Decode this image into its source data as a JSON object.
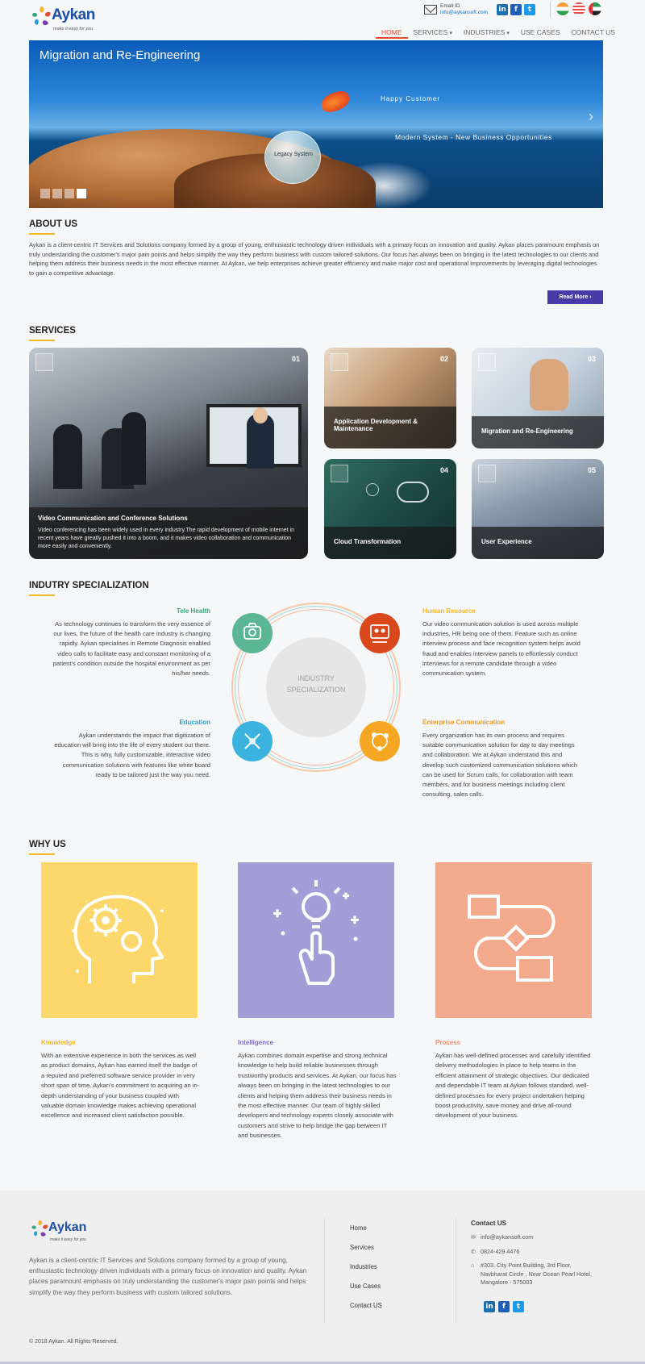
{
  "brand": {
    "name": "Aykan",
    "tagline": "make it easy for you"
  },
  "contact_top": {
    "label": "Email ID",
    "email": "info@aykansoft.com"
  },
  "social": [
    "linkedin-icon",
    "facebook-icon",
    "twitter-icon"
  ],
  "nav": [
    {
      "label": "HOME",
      "active": true,
      "dropdown": false
    },
    {
      "label": "SERVICES",
      "active": false,
      "dropdown": true
    },
    {
      "label": "INDUSTRIES",
      "active": false,
      "dropdown": true
    },
    {
      "label": "USE CASES",
      "active": false,
      "dropdown": false
    },
    {
      "label": "CONTACT US",
      "active": false,
      "dropdown": false
    }
  ],
  "hero": {
    "title": "Migration and Re-Engineering",
    "caption_top": "Happy Customer",
    "caption_bottom": "Modern System - New Business Opportunities",
    "bowl_label": "Legacy System"
  },
  "about": {
    "title": "ABOUT US",
    "text": "Aykan is a client-centric IT Services and Solutions company formed by a group of young, enthusiastic technology driven individuals with a primary focus on innovation and quality. Aykan places paramount emphasis on truly understanding the customer's major pain points and helps simplify the way they perform business with custom tailored solutions. Our focus has always been on bringing in the latest technologies to our clients and helping them address their business needs in the most effective manner. At Aykan, we help enterprises achieve greater efficiency and make major cost and operational improvements by leveraging digital technologies to gain a competitive advantage.",
    "button": "Read More ›"
  },
  "services": {
    "title": "SERVICES",
    "items": [
      {
        "num": "01",
        "title": "Video Communication and Conference Solutions",
        "desc": "Video conferencing has been widely used in every industry.The rapid development of mobile internet in recent years have greatly pushed it into a boom, and it makes video collaboration and communication more easily and conveniently."
      },
      {
        "num": "02",
        "title": "Application Development & Maintenance",
        "desc": ""
      },
      {
        "num": "03",
        "title": "Migration and Re-Engineering",
        "desc": ""
      },
      {
        "num": "04",
        "title": "Cloud Transformation",
        "desc": ""
      },
      {
        "num": "05",
        "title": "User Experience",
        "desc": ""
      }
    ]
  },
  "industry": {
    "title": "INDUTRY SPECIALIZATION",
    "center_label": "INDUSTRY SPECIALIZATION",
    "items": [
      {
        "title": "Tele Health",
        "color": "#3aa57a",
        "text": "As technology continues to transform the very essence of our lives, the future of the health care industry is changing rapidly. Aykan specialises in Remote Diagnosis enabled video calls to facilitate easy and constant monitoring of a patient's condition outside the hospital environment as per his/her needs."
      },
      {
        "title": "Human Resource",
        "color": "#f2b62c",
        "text": "Our video communication solution is used across multiple industries, HR being one of them. Feature such as online interview process and face recognition system helps avoid fraud and enables interview panels to effortlessly conduct interviews for a remote candidate through a video communication system."
      },
      {
        "title": "Education",
        "color": "#2b9fd6",
        "text": "Aykan understands the impact that digitization of education will bring into the life of every student out there. This is why, fully customizable, interactive video communication solutions with features like white board ready to be tailored just the way you need."
      },
      {
        "title": "Enterprise Communication",
        "color": "#f39a2c",
        "text": "Every organization has its own process and requires suitable communication solution for day to day meetings and collaboration. We at Aykan understand this and develop such customized communication solutions which can be used for Scrum calls, for collaboration with team members, and for business meetings including client consulting, sales calls."
      }
    ]
  },
  "why": {
    "title": "WHY US",
    "items": [
      {
        "title": "Knowledge",
        "color": "#f2b62c",
        "bg": "#fbd76c",
        "text": "With an extensive experience in both the services as well as product domains, Aykan has earned itself the badge of a reputed and preferred software service provider in very short span of time. Aykan's commitment to acquiring an in-depth understanding of your business coupled with valuable domain knowledge makes achieving operational excellence and increased client satisfaction possible."
      },
      {
        "title": "Intelligence",
        "color": "#7a6cc9",
        "bg": "#a49ed8",
        "text": "Aykan combines domain expertise and strong technical knowledge to help build reliable businesses through trustworthy products and services. At Aykan, our focus has always been on bringing in the latest technologies to our clients and helping them address their business needs in the most effective manner. Our team of highly skilled developers and technology experts closely associate with customers and strive to help bridge the gap between IT and businesses."
      },
      {
        "title": "Process",
        "color": "#f08a6a",
        "bg": "#f3aa8c",
        "text": "Aykan has well-defined processes and carefully identified delivery methodologies in place to help teams in the efficient attainment of strategic objectives. Our dedicated and dependable IT team at Aykan follows standard, well-defined processes for every project undertaken helping boost productivity, save money and drive all-round development of your business."
      }
    ]
  },
  "footer": {
    "desc": "Aykan is a client-centric IT Services and Solutions company formed by a group of young, enthusiastic technology driven individuals with a primary focus on innovation and quality. Aykan places paramount emphasis on truly understanding the customer's major pain points and helps simplify the way they perform business with custom tailored solutions.",
    "links": [
      "Home",
      "Services",
      "Industries",
      "Use Cases",
      "Contact US"
    ],
    "contact_title": "Contact US",
    "email": "info@aykansoft.com",
    "phone": "0824-429 4476",
    "address_1": "#303, City Point Building, 3rd Floor,",
    "address_2": "Navbharat Circle , Near Ocean Pearl Hotel,",
    "address_3": "Mangalore - 575003",
    "copyright": "© 2018 Aykan. All Rights Reserved."
  }
}
